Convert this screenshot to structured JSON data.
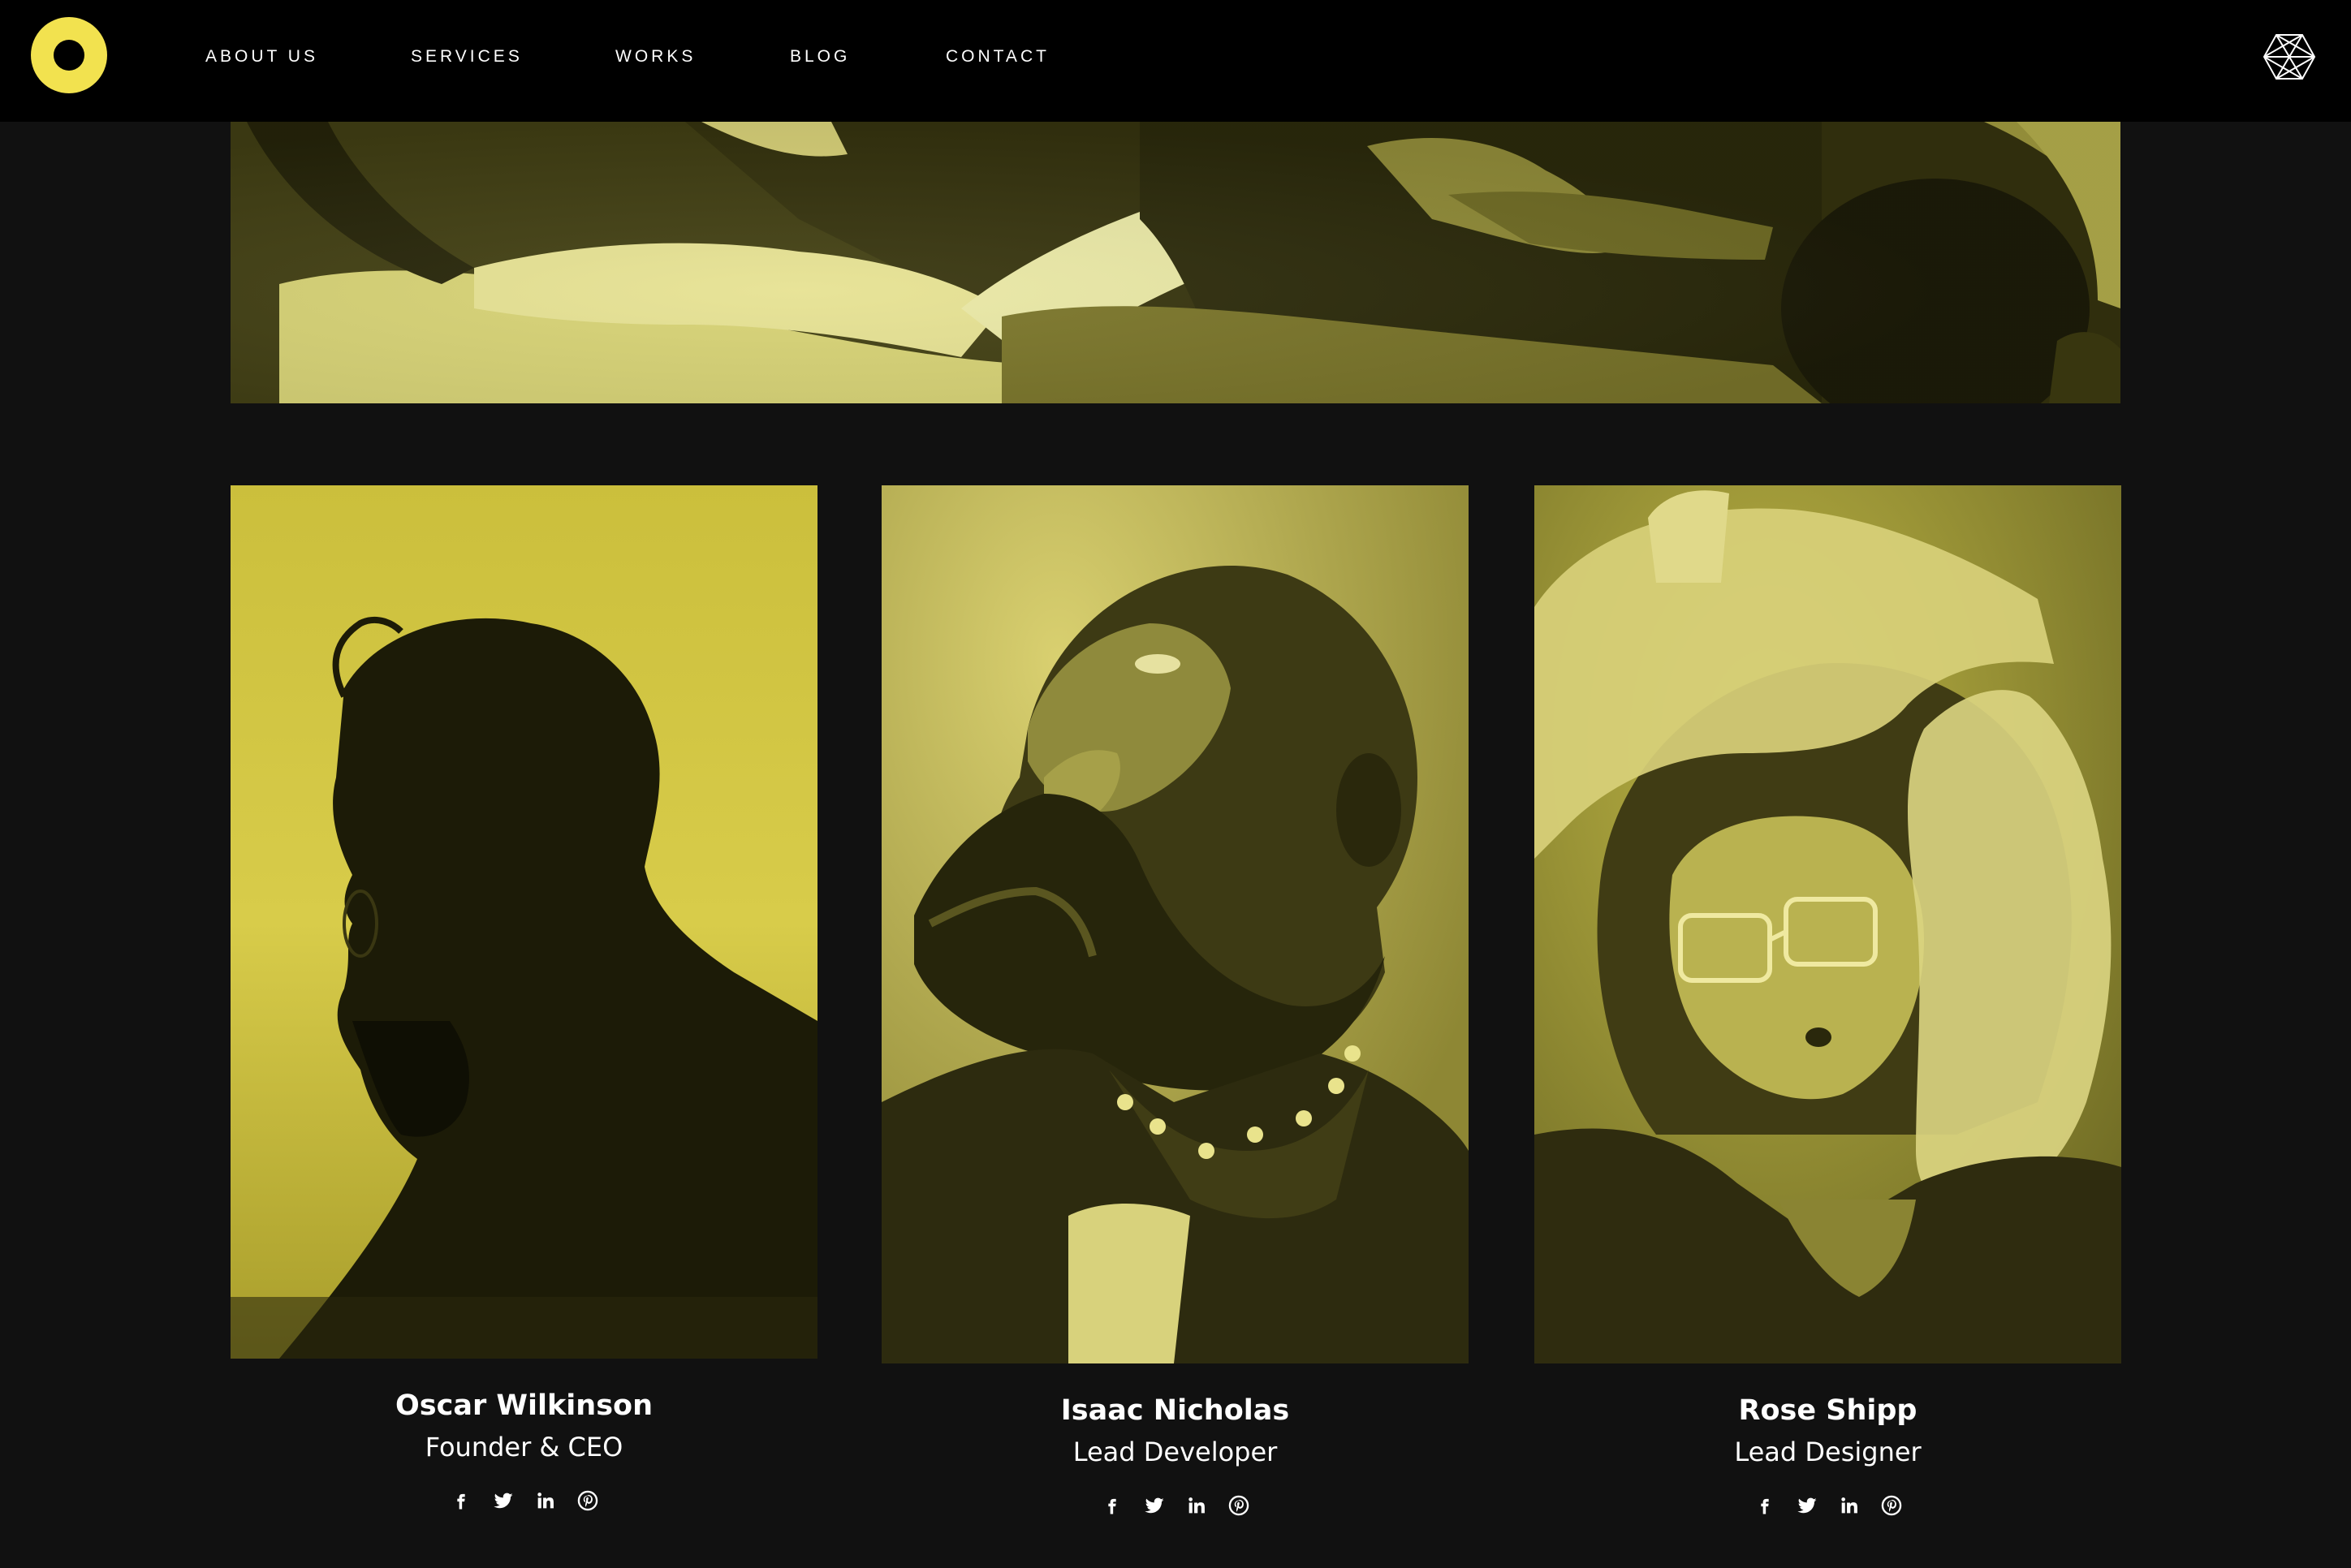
{
  "nav": {
    "items": [
      {
        "label": "ABOUT US"
      },
      {
        "label": "SERVICES"
      },
      {
        "label": "WORKS"
      },
      {
        "label": "BLOG"
      },
      {
        "label": "CONTACT"
      }
    ]
  },
  "colors": {
    "accent": "#f2e24f",
    "background": "#111111",
    "nav": "#000000",
    "text": "#ffffff",
    "photo_tint": "#d9cf4a"
  },
  "team": [
    {
      "name": "Oscar Wilkinson",
      "role": "Founder & CEO",
      "socials": [
        "facebook-icon",
        "twitter-icon",
        "linkedin-icon",
        "pinterest-icon"
      ]
    },
    {
      "name": "Isaac Nicholas",
      "role": "Lead Developer",
      "socials": [
        "facebook-icon",
        "twitter-icon",
        "linkedin-icon",
        "pinterest-icon"
      ]
    },
    {
      "name": "Rose Shipp",
      "role": "Lead Designer",
      "socials": [
        "facebook-icon",
        "twitter-icon",
        "linkedin-icon",
        "pinterest-icon"
      ]
    }
  ]
}
